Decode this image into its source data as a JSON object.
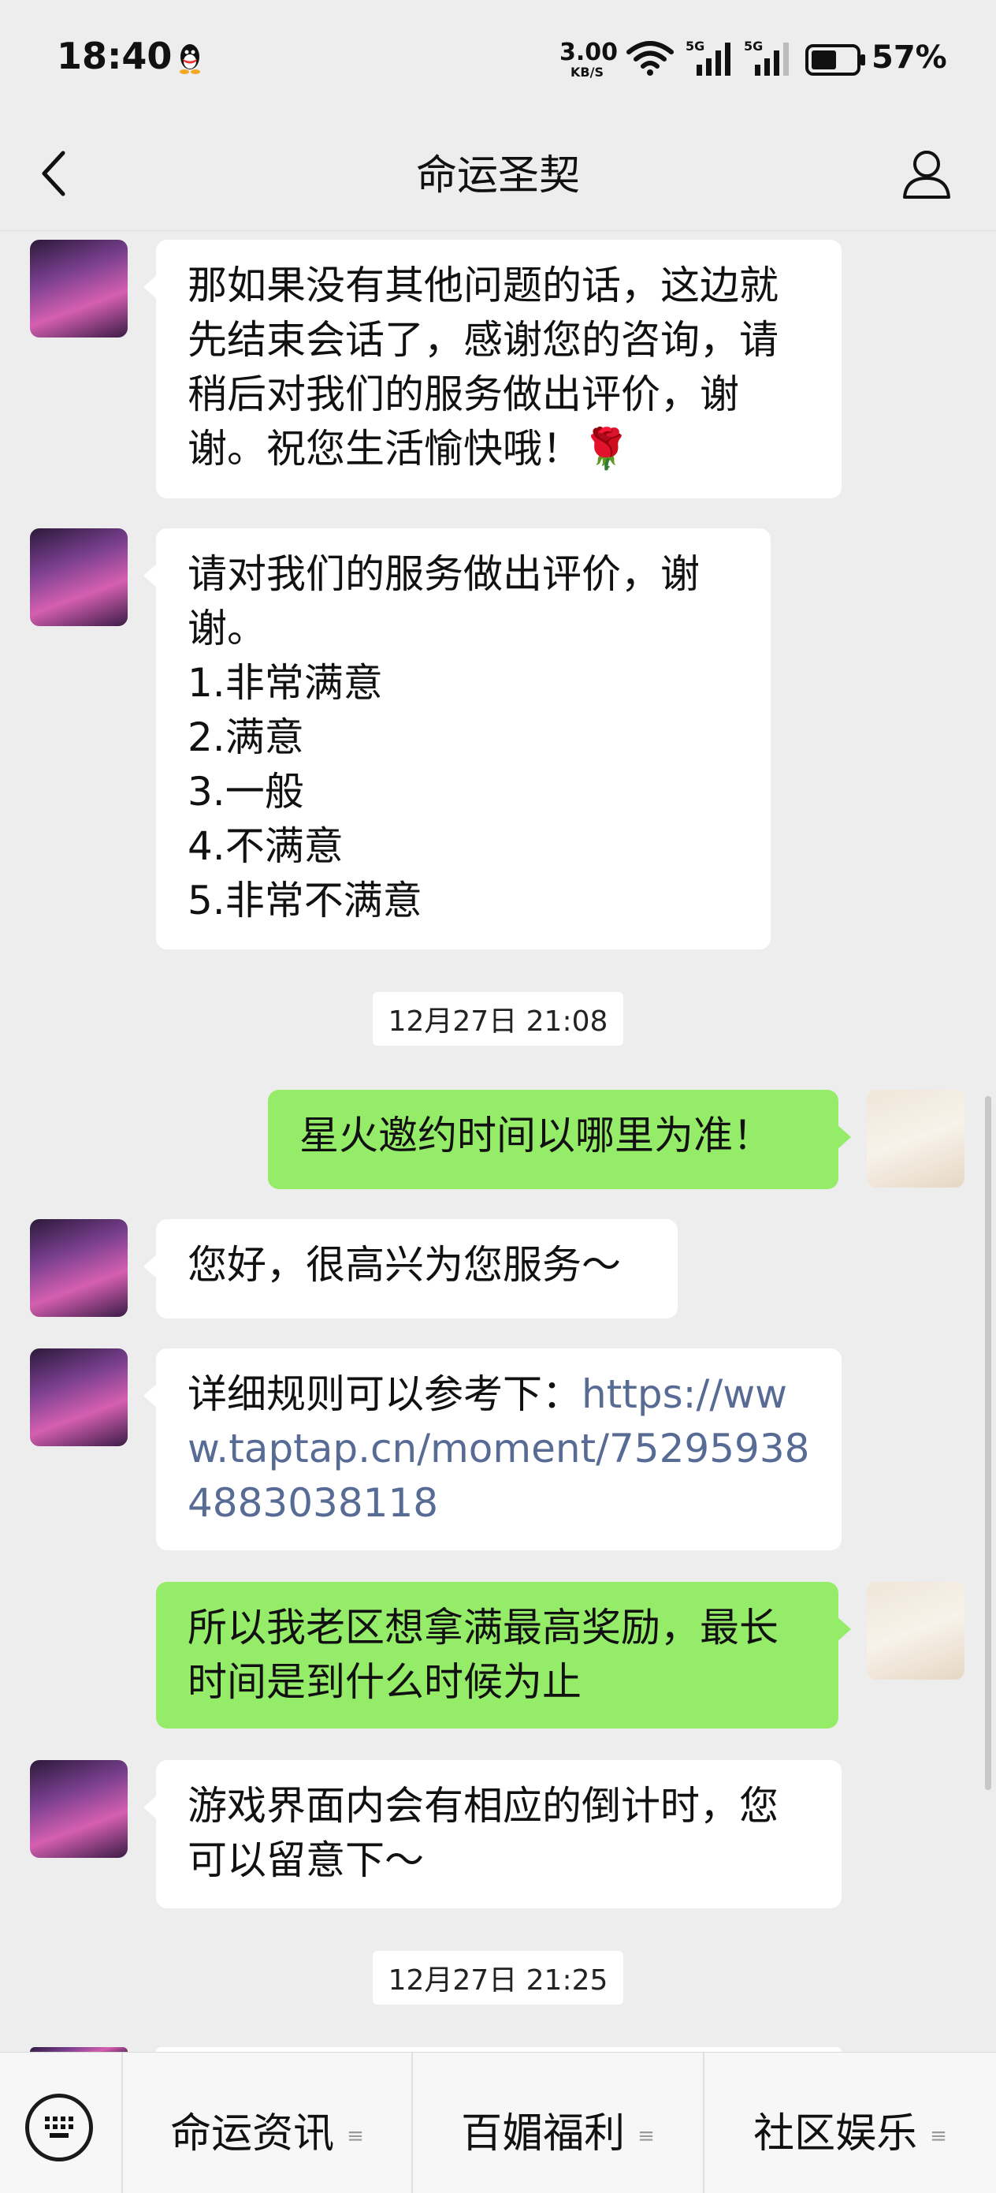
{
  "status_bar": {
    "time": "18:40",
    "net_speed_value": "3.00",
    "net_speed_unit": "KB/S",
    "signal1_label": "5G",
    "signal2_label": "5G",
    "battery_pct": "57%",
    "battery_level": 0.57,
    "icons": [
      "qq-icon",
      "wifi-icon",
      "signal-icon",
      "signal-icon",
      "battery-icon"
    ]
  },
  "header": {
    "title": "命运圣契",
    "back_icon": "chevron-left-icon",
    "profile_icon": "person-icon"
  },
  "messages": [
    {
      "side": "in",
      "text": "那如果没有其他问题的话，这边就先结束会话了，感谢您的咨询，请稍后对我们的服务做出评价，谢谢。祝您生活愉快哦！🌹"
    },
    {
      "side": "in",
      "text": "请对我们的服务做出评价，谢谢。\n1.非常满意\n2.满意\n3.一般\n4.不满意\n5.非常不满意"
    },
    {
      "side": "time",
      "text": "12月27日 21:08"
    },
    {
      "side": "out",
      "text": "星火邀约时间以哪里为准！"
    },
    {
      "side": "in",
      "text": "您好，很高兴为您服务～"
    },
    {
      "side": "in",
      "prefix": "详细规则可以参考下：",
      "link": "https://www.taptap.cn/moment/752959384883038118"
    },
    {
      "side": "out",
      "text": "所以我老区想拿满最高奖励，最长时间是到什么时候为止"
    },
    {
      "side": "in",
      "text": "游戏界面内会有相应的倒计时，您可以留意下～"
    },
    {
      "side": "time",
      "text": "12月27日 21:25"
    }
  ],
  "bottom_menu": {
    "keyboard_icon": "keyboard-icon",
    "items": [
      {
        "label": "命运资讯"
      },
      {
        "label": "百媚福利"
      },
      {
        "label": "社区娱乐"
      }
    ]
  },
  "colors": {
    "background": "#ededed",
    "incoming_bubble": "#ffffff",
    "outgoing_bubble": "#95ec69",
    "link": "#576b95"
  }
}
